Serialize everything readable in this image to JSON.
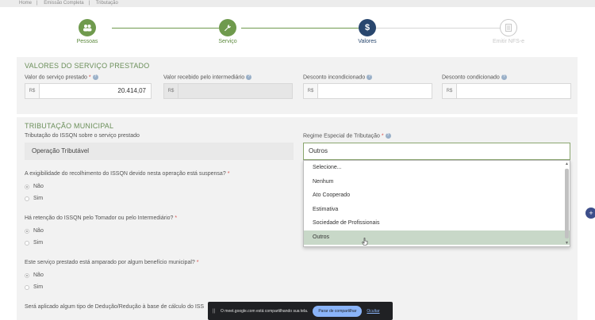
{
  "breadcrumb": [
    "Home",
    "Emissão Completa",
    "Tributação"
  ],
  "stepper": [
    {
      "label": "Pessoas",
      "icon": "people-icon",
      "state": "done"
    },
    {
      "label": "Serviço",
      "icon": "wrench-icon",
      "state": "done"
    },
    {
      "label": "Valores",
      "icon": "dollar-icon",
      "state": "active"
    },
    {
      "label": "Emitir NFS-e",
      "icon": "document-icon",
      "state": "todo"
    }
  ],
  "valores": {
    "title": "VALORES DO SERVIÇO PRESTADO",
    "fields": [
      {
        "label": "Valor do serviço prestado",
        "prefix": "R$",
        "value": "20.414,07"
      },
      {
        "label": "Valor recebido pelo intermediário",
        "prefix": "R$",
        "value": ""
      },
      {
        "label": "Desconto incondicionado",
        "prefix": "R$",
        "value": ""
      },
      {
        "label": "Desconto condicionado",
        "prefix": "R$",
        "value": ""
      }
    ]
  },
  "tributacao": {
    "title": "TRIBUTAÇÃO MUNICIPAL",
    "issqn_label": "Tributação do ISSQN sobre o serviço prestado",
    "issqn_value": "Operação Tributável",
    "regime_label": "Regime Especial de Tributação",
    "regime_value": "Outros",
    "regime_options": [
      "Selecione...",
      "Nenhum",
      "Ato Cooperado",
      "Estimativa",
      "Sociedade de Profissionais",
      "Outros"
    ],
    "q1": "A exigibilidade do recolhimento do ISSQN devido nesta operação está suspensa?",
    "q2": "Há retenção do ISSQN pelo Tomador ou pelo Intermediário?",
    "q3": "Este serviço prestado está amparado por algum benefício municipal?",
    "q4": "Será aplicado algum tipo de Dedução/Redução à base de cálculo do ISS",
    "opt_no": "Não",
    "opt_yes": "Sim"
  },
  "share_bar": {
    "text": "O meet.google.com está compartilhando sua tela.",
    "stop": "Parar de compartilhar",
    "hide": "Ocultar"
  },
  "fab": "+"
}
